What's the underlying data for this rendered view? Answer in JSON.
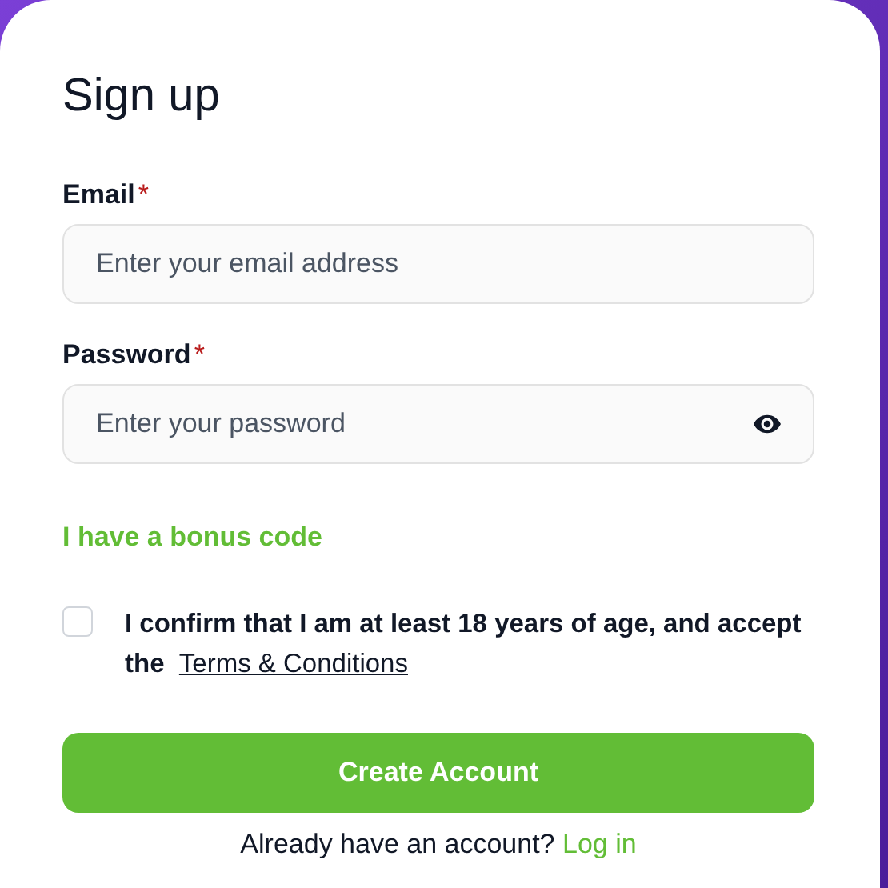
{
  "title": "Sign up",
  "fields": [
    {
      "label": "Email",
      "required_mark": "*",
      "placeholder": "Enter your email address",
      "kind": "text"
    },
    {
      "label": "Password",
      "required_mark": "*",
      "placeholder": "Enter your password",
      "kind": "password"
    }
  ],
  "bonus_link": "I have a bonus code",
  "consent": {
    "checked": false,
    "text": "I confirm that I am at least 18 years of age, and accept the",
    "link": "Terms & Conditions"
  },
  "submit": "Create Account",
  "footer": {
    "text": "Already have an account?",
    "link": "Log in"
  }
}
